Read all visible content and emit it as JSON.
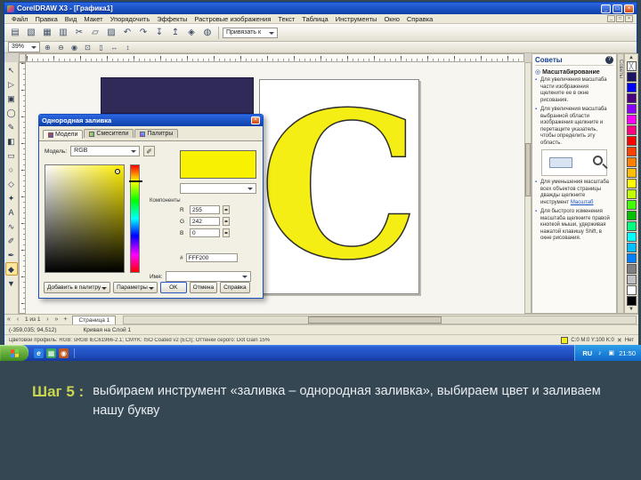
{
  "colors": {
    "fill_yellow": "#f4ee14",
    "navy_object": "#2f2a58",
    "caption_label": "#c9d64f"
  },
  "window": {
    "title": "CorelDRAW X3 - [Графика1]",
    "controls": {
      "minimize": "_",
      "maximize": "□",
      "close": "×"
    },
    "menu_items": [
      "Файл",
      "Правка",
      "Вид",
      "Макет",
      "Упорядочить",
      "Эффекты",
      "Растровые изображения",
      "Текст",
      "Таблица",
      "Инструменты",
      "Окно",
      "Справка"
    ]
  },
  "standard_toolbar": {
    "icons": [
      {
        "name": "new-document-icon",
        "glyph": "▤"
      },
      {
        "name": "open-icon",
        "glyph": "▧"
      },
      {
        "name": "save-icon",
        "glyph": "▦"
      },
      {
        "name": "print-icon",
        "glyph": "▥"
      },
      {
        "name": "cut-icon",
        "glyph": "✂"
      },
      {
        "name": "copy-icon",
        "glyph": "▱"
      },
      {
        "name": "paste-icon",
        "glyph": "▨"
      },
      {
        "name": "undo-icon",
        "glyph": "↶"
      },
      {
        "name": "redo-icon",
        "glyph": "↷"
      },
      {
        "name": "import-icon",
        "glyph": "↧"
      },
      {
        "name": "export-icon",
        "glyph": "↥"
      },
      {
        "name": "application-launcher-icon",
        "glyph": "◈"
      },
      {
        "name": "corel-online-icon",
        "glyph": "◍"
      }
    ],
    "snap_label": "Привязать к"
  },
  "property_bar": {
    "zoom_value": "39%",
    "icons": [
      {
        "name": "zoom-in-icon",
        "glyph": "⊕"
      },
      {
        "name": "zoom-out-icon",
        "glyph": "⊖"
      },
      {
        "name": "zoom-selected-icon",
        "glyph": "◉"
      },
      {
        "name": "zoom-all-objects-icon",
        "glyph": "⊡"
      },
      {
        "name": "zoom-page-icon",
        "glyph": "▯"
      },
      {
        "name": "zoom-page-width-icon",
        "glyph": "↔"
      },
      {
        "name": "zoom-page-height-icon",
        "glyph": "↕"
      }
    ]
  },
  "toolbox": {
    "tools": [
      {
        "name": "pick-tool",
        "glyph": "↖"
      },
      {
        "name": "shape-tool",
        "glyph": "▷"
      },
      {
        "name": "crop-tool",
        "glyph": "▣"
      },
      {
        "name": "zoom-tool",
        "glyph": "◯"
      },
      {
        "name": "freehand-tool",
        "glyph": "✎"
      },
      {
        "name": "smart-fill-tool",
        "glyph": "◧"
      },
      {
        "name": "rectangle-tool",
        "glyph": "▭"
      },
      {
        "name": "ellipse-tool",
        "glyph": "○"
      },
      {
        "name": "polygon-tool",
        "glyph": "◇"
      },
      {
        "name": "basic-shapes-tool",
        "glyph": "✦"
      },
      {
        "name": "text-tool",
        "glyph": "А"
      },
      {
        "name": "interactive-blend-tool",
        "glyph": "∿"
      },
      {
        "name": "eyedropper-tool",
        "glyph": "✐"
      },
      {
        "name": "outline-tool",
        "glyph": "✒"
      },
      {
        "name": "fill-tool",
        "glyph": "◆",
        "active": true
      },
      {
        "name": "interactive-fill-tool",
        "glyph": "▼"
      }
    ]
  },
  "canvas": {
    "letter": "C"
  },
  "dialog": {
    "title": "Однородная заливка",
    "tabs": [
      "Модели",
      "Смесители",
      "Палитры"
    ],
    "model_label": "Модель:",
    "model_value": "RGB",
    "eyedropper_glyph": "✐",
    "new_color": "#f8f200",
    "components_label": "Компоненты",
    "components": [
      {
        "label": "R",
        "value": "255"
      },
      {
        "label": "G",
        "value": "242"
      },
      {
        "label": "B",
        "value": "0"
      }
    ],
    "hex_label": "#",
    "hex_value": "FFF200",
    "name_label": "Имя:",
    "name_value": "",
    "buttons": {
      "add_to_palette": "Добавить в палитру",
      "options": "Параметры",
      "ok": "OK",
      "cancel": "Отмена",
      "help": "Справка"
    }
  },
  "docker": {
    "title": "Советы",
    "help_glyph": "?",
    "section_title": "Масштабирование",
    "section_glyph": "◎",
    "tips": [
      {
        "text": "Для увеличения масштаба части изображения щелкните ее в окне рисования."
      },
      {
        "text": "Для увеличения масштаба выбранной области изображения щелкните и перетащите указатель, чтобы определить эту область."
      },
      {
        "text": "Для уменьшения масштаба всех объектов страницы дважды щелкните инструмент ",
        "link": "Масштаб"
      },
      {
        "text": "Для быстрого изменения масштаба щелкните правой кнопкой мыши, удерживая нажатой клавишу Shift, в окне рисования."
      }
    ]
  },
  "docker_tab": "Советы",
  "palette": {
    "none_glyph": "╳",
    "colors": [
      "none",
      "#1b1464",
      "#0000ff",
      "#4b0082",
      "#8b00ff",
      "#ff00ff",
      "#ff0080",
      "#ff0000",
      "#ff4000",
      "#ff8000",
      "#ffbf00",
      "#ffff00",
      "#bfff00",
      "#40ff00",
      "#00c000",
      "#00ff80",
      "#00ffff",
      "#00bfff",
      "#0080ff",
      "#808080",
      "#c0c0c0",
      "#ffffff",
      "#000000"
    ]
  },
  "page_nav": {
    "first": "«",
    "prev": "‹",
    "pages": "1 из 1",
    "next": "›",
    "last": "»",
    "add": "+",
    "page_tab": "Страница 1"
  },
  "status": {
    "coords": "(-359,035; 94,512)",
    "object_info": "Кривая на Слой 1",
    "profile": "Цветовой профиль: RGB: sRGB IEC61966-2.1; CMYK: ISO Coated v2 (ECI); Оттенки серого: Dot Gain 15%",
    "fill_value": "C:0 M:0 Y:100 K:0",
    "outline_glyph": "✕",
    "outline_value": "Нет"
  },
  "taskbar": {
    "language": "RU",
    "volume_glyph": "♪",
    "shield_glyph": "▣",
    "clock": "21:50"
  },
  "caption": {
    "label": "Шаг 5 :",
    "text": "выбираем инструмент «заливка – однородная заливка», выбираем цвет и заливаем нашу букву"
  }
}
